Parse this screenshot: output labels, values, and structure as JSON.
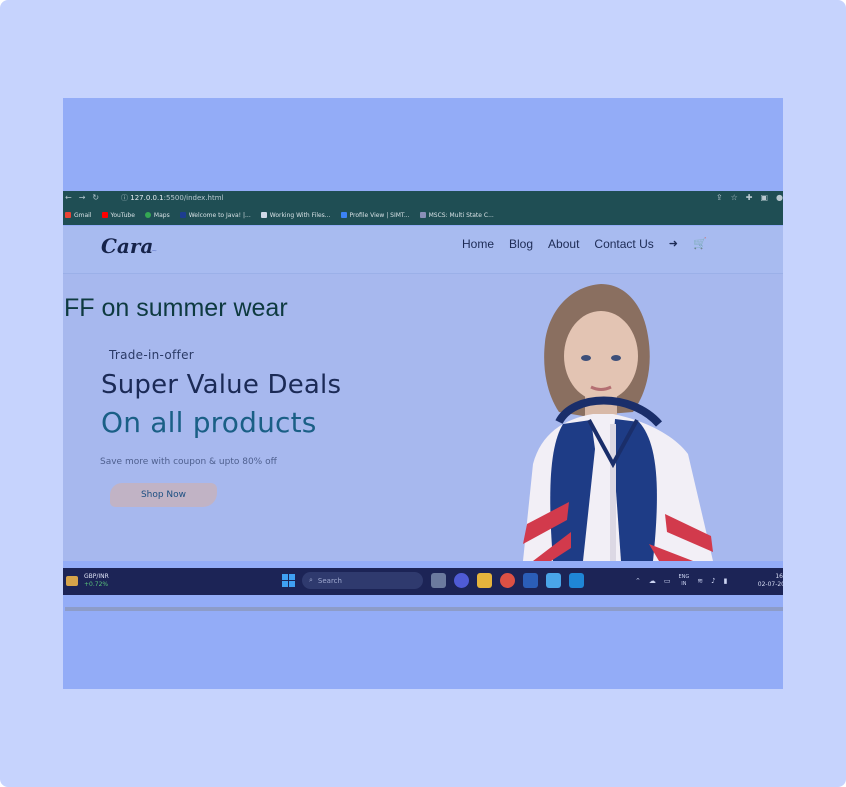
{
  "browser": {
    "url_host": "127.0.0.1",
    "url_path": ":5500/index.html",
    "bookmarks": [
      {
        "label": "Gmail",
        "color": "#ea4335"
      },
      {
        "label": "YouTube",
        "color": "#ff0000"
      },
      {
        "label": "Maps",
        "color": "#34a853"
      },
      {
        "label": "Welcome to Java! |...",
        "color": "#1d3d8f"
      },
      {
        "label": "Working With Files...",
        "color": "#cfd8e6"
      },
      {
        "label": "Profile View | SIMT...",
        "color": "#3b82f6"
      },
      {
        "label": "MSCS: Multi State C...",
        "color": "#8a8fb8"
      }
    ]
  },
  "site": {
    "logo": "Cara",
    "nav": {
      "home": "Home",
      "blog": "Blog",
      "about": "About",
      "contact": "Contact Us"
    },
    "hero": {
      "marquee": "FF on summer wear",
      "subheading": "Trade-in-offer",
      "heading": "Super Value Deals",
      "highlight": "On all products",
      "tagline": "Save more with coupon & upto 80% off",
      "button": "Shop Now"
    }
  },
  "taskbar": {
    "ticker_name": "GBP/INR",
    "ticker_change": "+0.72%",
    "search_placeholder": "Search",
    "lang_top": "ENG",
    "lang_bottom": "IN",
    "time": "16:",
    "date": "02-07-20"
  }
}
